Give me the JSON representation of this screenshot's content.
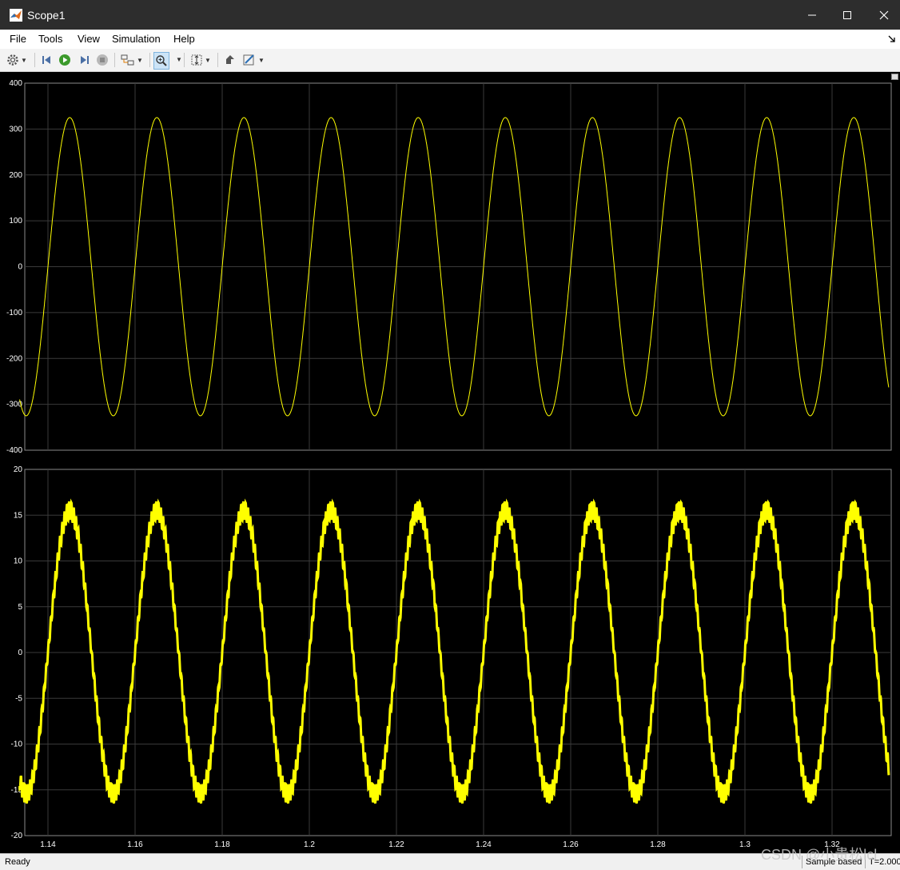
{
  "window": {
    "title": "Scope1",
    "controls": [
      "minimize",
      "maximize",
      "close"
    ]
  },
  "menu": {
    "items": [
      "File",
      "Tools",
      "View",
      "Simulation",
      "Help"
    ]
  },
  "toolbar": {
    "icons": [
      "settings-gear-icon",
      "step-back-icon",
      "run-icon",
      "step-forward-icon",
      "stop-icon",
      "highlight-block-icon",
      "zoom-icon",
      "autoscale-icon",
      "style-icon",
      "measure-icon"
    ]
  },
  "status": {
    "ready": "Ready",
    "mode": "Sample based",
    "time": "T=2.000"
  },
  "watermark": "CSDN @小贵松lcl",
  "colors": {
    "trace": "#ffff00",
    "background": "#000000",
    "grid": "#3a3a3a"
  },
  "chart_data": [
    {
      "type": "line",
      "series": [
        {
          "amplitude": 325,
          "frequency_hz": 50,
          "phase_ref_peak_t": 1.145,
          "values_desc": "sinusoid"
        }
      ],
      "x": {
        "range": [
          1.1335,
          1.333
        ]
      },
      "ylim": [
        -400,
        400
      ],
      "yticks": [
        "400",
        "300",
        "200",
        "100",
        "0",
        "-100",
        "-200",
        "-300",
        "-400"
      ],
      "grid": true
    },
    {
      "type": "line",
      "series": [
        {
          "amplitude": 15.5,
          "frequency_hz": 50,
          "phase_ref_peak_t": 1.145,
          "ripple": 1.0,
          "values_desc": "noisy sinusoid"
        }
      ],
      "x": {
        "range": [
          1.1335,
          1.333
        ]
      },
      "ylim": [
        -20,
        20
      ],
      "yticks": [
        "20",
        "15",
        "10",
        "5",
        "0",
        "-5",
        "-10",
        "-15",
        "-20"
      ],
      "xticks": [
        "1.14",
        "1.16",
        "1.18",
        "1.2",
        "1.22",
        "1.24",
        "1.26",
        "1.28",
        "1.3",
        "1.32"
      ],
      "grid": true
    }
  ]
}
